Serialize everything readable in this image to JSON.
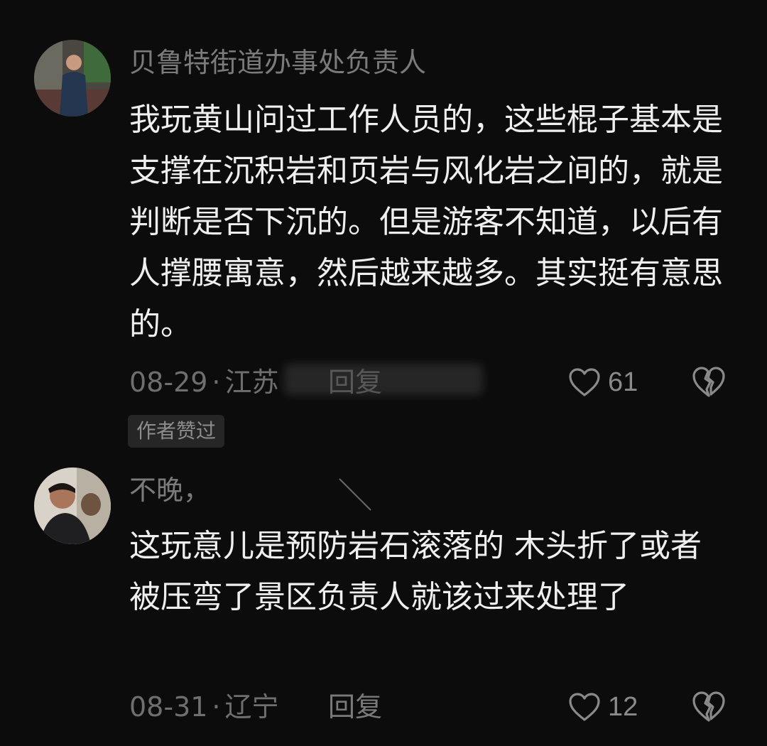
{
  "comments": [
    {
      "username": "贝鲁特街道办事处负责人",
      "content": "我玩黄山问过工作人员的，这些棍子基本是支撑在沉积岩和页岩与风化岩之间的，就是判断是否下沉的。但是游客不知道，以后有人撑腰寓意，然后越来越多。其实挺有意思的。",
      "date": "08-29",
      "location": "江苏",
      "reply_label": "回复",
      "likes": "61",
      "badge": "作者赞过"
    },
    {
      "username": "不晚，",
      "content": "这玩意儿是预防岩石滚落的 木头折了或者被压弯了景区负责人就该过来处理了",
      "date": "08-31",
      "location": "辽宁",
      "reply_label": "回复",
      "likes": "12"
    }
  ],
  "colors": {
    "background": "#0c0c0c",
    "text": "#efefef",
    "muted": "#7b7b7b"
  },
  "icons": [
    "heart-outline-icon",
    "broken-heart-icon"
  ]
}
